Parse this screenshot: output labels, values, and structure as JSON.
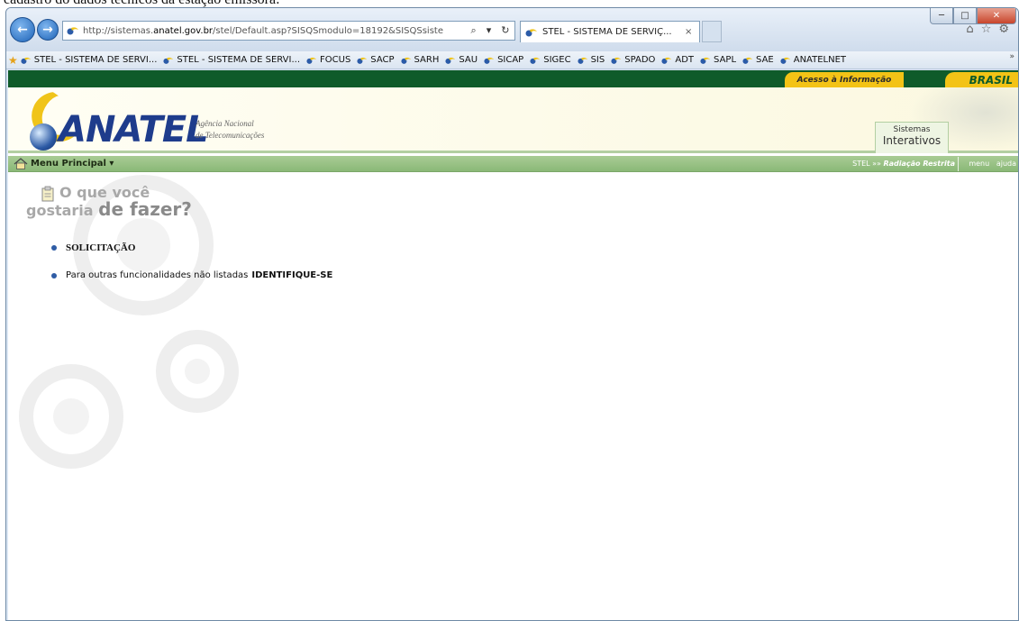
{
  "doc_caption": "cadastro do dados técnicos da estação emissora:",
  "browser": {
    "address_url_prefix": "http://sistemas.",
    "address_url_domain": "anatel.gov.br",
    "address_url_suffix": "/stel/Default.asp?SISQSmodulo=18192&SISQSsiste",
    "tab_title": "STEL - SISTEMA DE SERVIÇ...",
    "tab_close": "×",
    "favorites": [
      "STEL - SISTEMA DE SERVI...",
      "STEL - SISTEMA DE SERVI...",
      "FOCUS",
      "SACP",
      "SARH",
      "SAU",
      "SICAP",
      "SIGEC",
      "SIS",
      "SPADO",
      "ADT",
      "SAPL",
      "SAE",
      "ANATELNET"
    ]
  },
  "site": {
    "acesso": "Acesso à Informação",
    "brasil": "BRASIL",
    "logo": "ANATEL",
    "agencia_l1": "Agência Nacional",
    "agencia_l2": "de Telecomunicações",
    "sistemas_l1": "Sistemas",
    "sistemas_l2": "Interativos",
    "menu_principal": "Menu Principal ▾",
    "crumb_prefix": "STEL »» ",
    "crumb_current": "Radiação Restrita",
    "menu_link": "menu",
    "ajuda_link": "ajuda"
  },
  "content": {
    "q_line1": "O que você",
    "q_line2a": "gostaria ",
    "q_line2b": "de fazer?",
    "opt1": "SOLICITAÇÃO",
    "opt2_text": "Para outras funcionalidades não listadas",
    "opt2_link": "IDENTIFIQUE-SE"
  }
}
